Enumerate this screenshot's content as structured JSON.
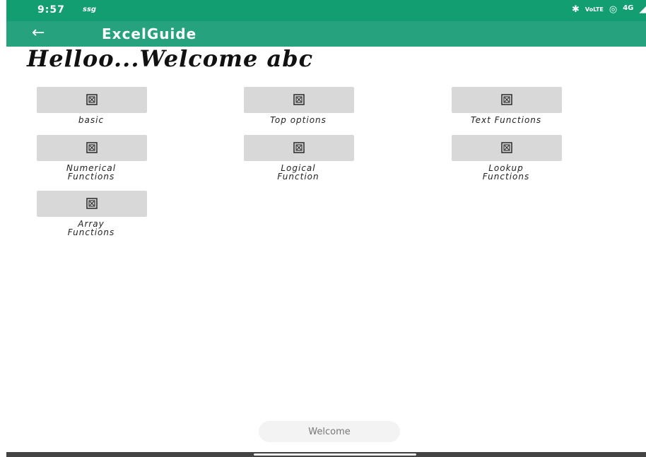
{
  "status_bar": {
    "time": "9:57",
    "extra": "ssg",
    "icons": [
      "bluetooth-icon",
      "volte-icon",
      "hotspot-icon",
      "4g-signal-icon",
      "battery-icon"
    ],
    "network": "4G"
  },
  "app_bar": {
    "title": "ExcelGuide"
  },
  "greeting": "Helloo...Welcome abc",
  "tiles": [
    {
      "label": "basic"
    },
    {
      "label": "Top options"
    },
    {
      "label": "Text Functions"
    },
    {
      "label": "Numerical Functions"
    },
    {
      "label": "Logical Function"
    },
    {
      "label": "Lookup Functions"
    },
    {
      "label": "Array Functions"
    }
  ],
  "welcome_button": "Welcome",
  "colors": {
    "status_bar": "#139e71",
    "app_bar": "#26a37e",
    "tile": "#d8d8d8"
  }
}
